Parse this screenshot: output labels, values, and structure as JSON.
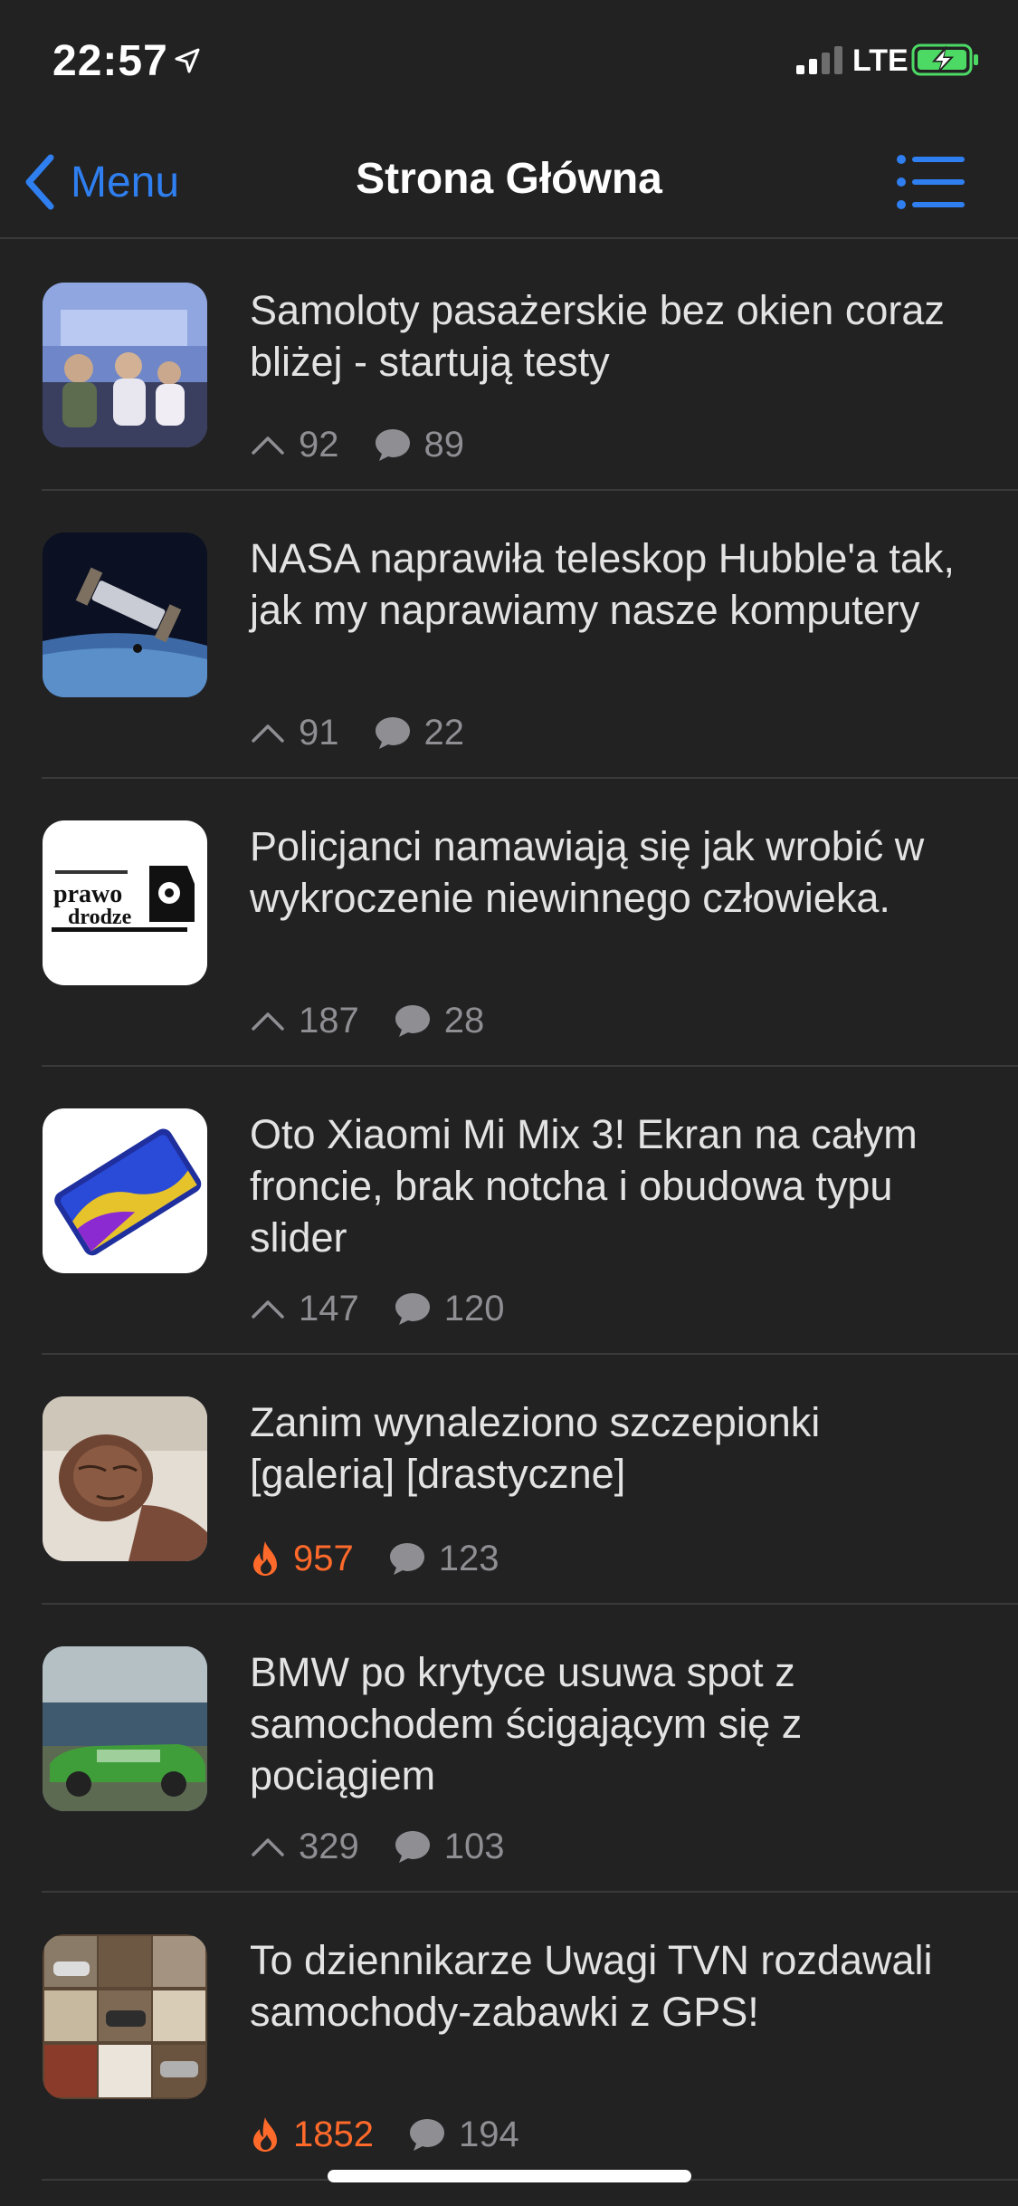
{
  "status": {
    "time": "22:57",
    "network": "LTE"
  },
  "nav": {
    "back_label": "Menu",
    "title": "Strona Główna"
  },
  "colors": {
    "accent": "#2f7ff0",
    "hot": "#ff6a2a",
    "background": "#222223",
    "battery": "#4cd964"
  },
  "articles": [
    {
      "title": "Samoloty pasażerskie bez okien coraz bliżej - startują testy",
      "score": "92",
      "comments": "89",
      "hot": false,
      "score_icon": "upvote-icon"
    },
    {
      "title": "NASA naprawiła teleskop Hubble'a tak, jak my naprawiamy nasze komputery",
      "score": "91",
      "comments": "22",
      "hot": false,
      "score_icon": "upvote-icon"
    },
    {
      "title": "Policjanci namawiają się jak wrobić w wykroczenie niewinnego człowieka.",
      "score": "187",
      "comments": "28",
      "hot": false,
      "score_icon": "upvote-icon"
    },
    {
      "title": "Oto Xiaomi Mi Mix 3! Ekran na całym froncie, brak notcha i obudowa typu slider",
      "score": "147",
      "comments": "120",
      "hot": false,
      "score_icon": "upvote-icon"
    },
    {
      "title": "Zanim wynaleziono szczepionki [galeria] [drastyczne]",
      "score": "957",
      "comments": "123",
      "hot": true,
      "score_icon": "flame-icon"
    },
    {
      "title": "BMW po krytyce usuwa spot z samochodem ścigającym się z pociągiem",
      "score": "329",
      "comments": "103",
      "hot": false,
      "score_icon": "upvote-icon"
    },
    {
      "title": "To dziennikarze Uwagi TVN rozdawali samochody-zabawki z GPS!",
      "score": "1852",
      "comments": "194",
      "hot": true,
      "score_icon": "flame-icon"
    }
  ]
}
